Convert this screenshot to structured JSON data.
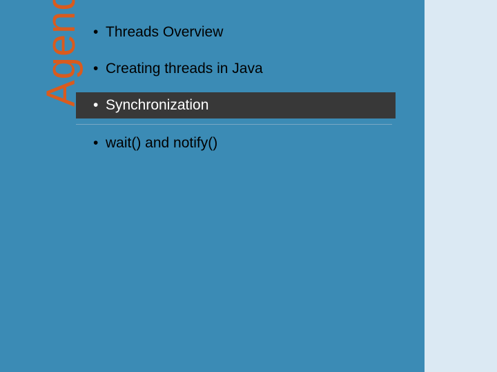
{
  "title": "Agenda",
  "items": [
    {
      "text": "Threads Overview",
      "highlight": false
    },
    {
      "text": "Creating threads in Java",
      "highlight": false
    },
    {
      "text": "Synchronization",
      "highlight": true
    },
    {
      "text": "wait() and notify()",
      "highlight": false
    }
  ]
}
